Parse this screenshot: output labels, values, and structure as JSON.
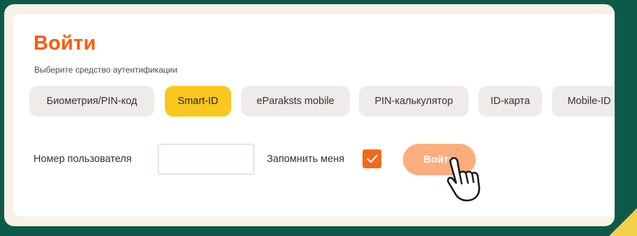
{
  "login": {
    "title": "Войти",
    "subtitle": "Выберите средство аутентификации"
  },
  "methods": [
    {
      "label": "Биометрия/PIN-код",
      "active": false
    },
    {
      "label": "Smart-ID",
      "active": true
    },
    {
      "label": "eParaksts mobile",
      "active": false
    },
    {
      "label": "PIN-калькулятор",
      "active": false
    },
    {
      "label": "ID-карта",
      "active": false
    },
    {
      "label": "Mobile-ID",
      "active": false
    }
  ],
  "form": {
    "user_label": "Номер пользователя",
    "user_value": "",
    "user_placeholder": "",
    "remember_label": "Запомнить меня",
    "remember_checked": true,
    "submit_label": "Войти"
  },
  "icons": {
    "checkmark": "check-icon",
    "cursor": "hand-pointer-icon"
  },
  "colors": {
    "accent": "#ff5a00",
    "active_method": "#f9c71e",
    "checkbox": "#f06a1e",
    "button": "#fcad7e",
    "frame": "#0e5a4a"
  }
}
